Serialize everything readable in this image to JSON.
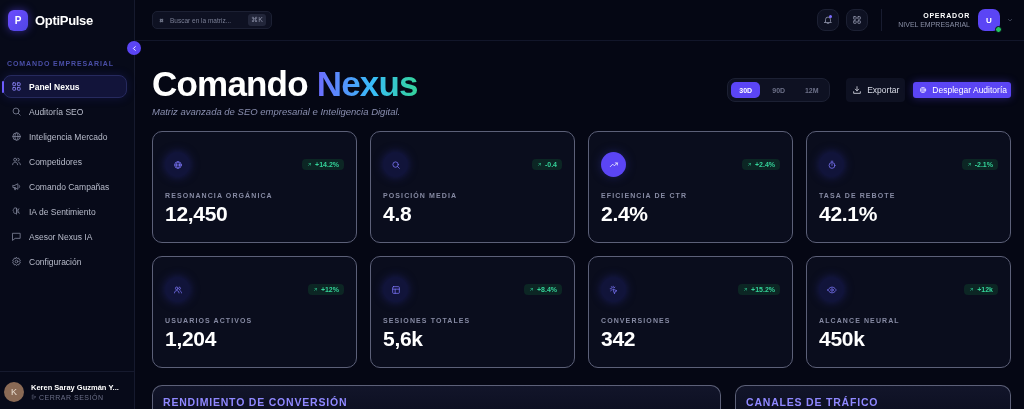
{
  "sidebar": {
    "brand": {
      "logo_letter": "P",
      "name": "OptiPulse"
    },
    "section_label": "COMANDO EMPRESARIAL",
    "items": [
      {
        "label": "Panel Nexus",
        "selected": true
      },
      {
        "label": "Auditoría SEO",
        "selected": false
      },
      {
        "label": "Inteligencia Mercado",
        "selected": false
      },
      {
        "label": "Competidores",
        "selected": false
      },
      {
        "label": "Comando Campañas",
        "selected": false
      },
      {
        "label": "IA de Sentimiento",
        "selected": false
      },
      {
        "label": "Asesor Nexus IA",
        "selected": false
      },
      {
        "label": "Configuración",
        "selected": false
      }
    ],
    "user": {
      "avatar_letter": "K",
      "name": "Keren Saray Guzmán Y...",
      "action": "CERRAR SESIÓN"
    }
  },
  "topbar": {
    "search": {
      "placeholder": "Buscar en la matriz...",
      "shortcut": "⌘K"
    },
    "notifications": {
      "unread": true
    },
    "user": {
      "role": "OPERADOR",
      "level": "NIVEL EMPRESARIAL",
      "avatar_letter": "U",
      "online": true
    }
  },
  "hero": {
    "title": "Comando",
    "title_accent": "Nexus",
    "subtitle": "Matriz avanzada de SEO empresarial e Inteligencia Digital.",
    "periods": [
      {
        "label": "30D",
        "selected": true
      },
      {
        "label": "90D",
        "selected": false
      },
      {
        "label": "12M",
        "selected": false
      }
    ],
    "buttons": [
      {
        "label": "Exportar",
        "kind": "secondary"
      },
      {
        "label": "Desplegar Auditoría",
        "kind": "primary"
      }
    ]
  },
  "stats": [
    {
      "label": "RESONANCIA ORGÁNICA",
      "value": "12,450",
      "change": "+14.2%",
      "highlighted": false
    },
    {
      "label": "POSICIÓN MEDIA",
      "value": "4.8",
      "change": "-0.4",
      "highlighted": false
    },
    {
      "label": "EFICIENCIA DE CTR",
      "value": "2.4%",
      "change": "+2.4%",
      "highlighted": true
    },
    {
      "label": "TASA DE REBOTE",
      "value": "42.1%",
      "change": "-2.1%",
      "highlighted": false
    },
    {
      "label": "USUARIOS ACTIVOS",
      "value": "1,204",
      "change": "+12%",
      "highlighted": false
    },
    {
      "label": "SESIONES TOTALES",
      "value": "5,6k",
      "change": "+8.4%",
      "highlighted": false
    },
    {
      "label": "CONVERSIONES",
      "value": "342",
      "change": "+15.2%",
      "highlighted": false
    },
    {
      "label": "ALCANCE NEURAL",
      "value": "450k",
      "change": "+12k",
      "highlighted": false
    }
  ],
  "panels": [
    {
      "title": "RENDIMIENTO DE CONVERSIÓN"
    },
    {
      "title": "CANALES DE TRÁFICO"
    }
  ]
}
